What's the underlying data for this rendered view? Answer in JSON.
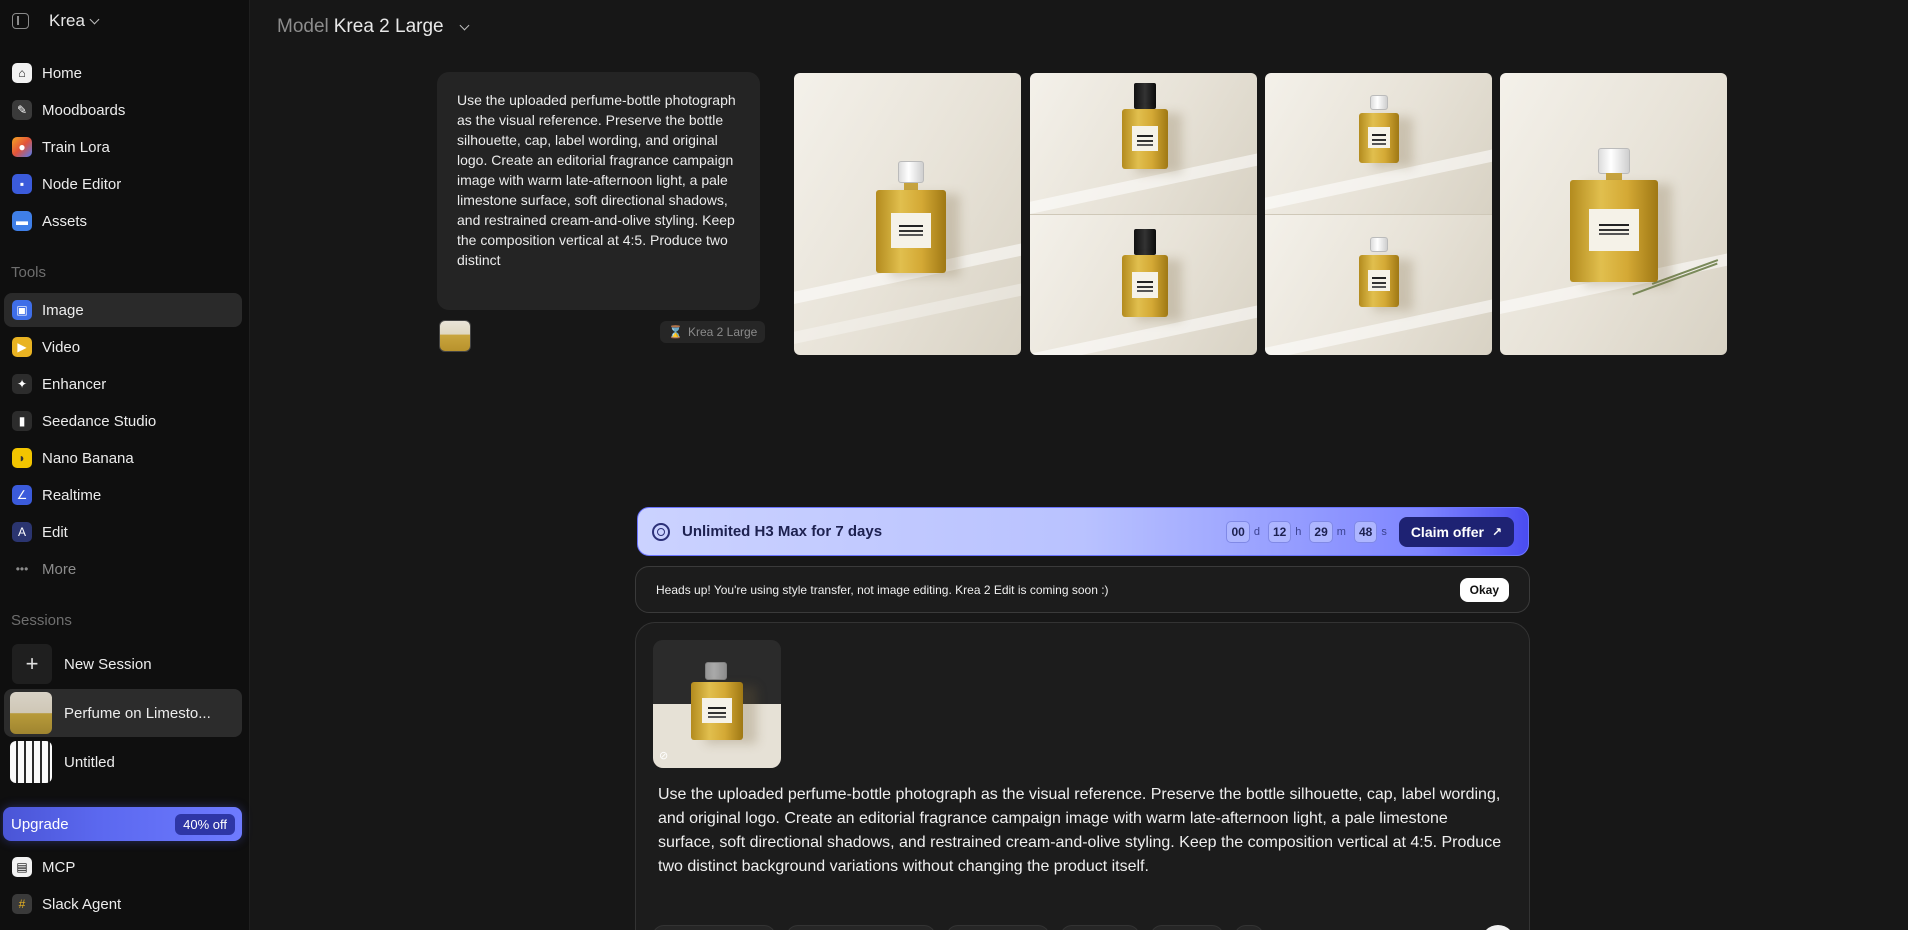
{
  "app": {
    "name": "Krea"
  },
  "sidebar": {
    "nav": [
      {
        "label": "Home",
        "icon": "home-icon"
      },
      {
        "label": "Moodboards",
        "icon": "moodboard-icon"
      },
      {
        "label": "Train Lora",
        "icon": "train-lora-icon"
      },
      {
        "label": "Node Editor",
        "icon": "node-editor-icon"
      },
      {
        "label": "Assets",
        "icon": "folder-icon"
      }
    ],
    "tools_label": "Tools",
    "tools": [
      {
        "label": "Image",
        "icon": "image-icon"
      },
      {
        "label": "Video",
        "icon": "video-icon"
      },
      {
        "label": "Enhancer",
        "icon": "enhancer-icon"
      },
      {
        "label": "Seedance Studio",
        "icon": "seedance-icon"
      },
      {
        "label": "Nano Banana",
        "icon": "banana-icon"
      },
      {
        "label": "Realtime",
        "icon": "realtime-icon"
      },
      {
        "label": "Edit",
        "icon": "edit-icon"
      },
      {
        "label": "More",
        "icon": "more-icon"
      }
    ],
    "sessions_label": "Sessions",
    "new_session": "New Session",
    "sessions": [
      {
        "label": "Perfume on Limesto..."
      },
      {
        "label": "Untitled"
      }
    ],
    "upgrade": {
      "label": "Upgrade",
      "badge": "40% off"
    },
    "footer": [
      {
        "label": "MCP",
        "icon": "mcp-icon"
      },
      {
        "label": "Slack Agent",
        "icon": "slack-icon"
      }
    ]
  },
  "header": {
    "model_prefix": "Model",
    "model_value": "Krea 2 Large"
  },
  "history": {
    "prompt": "Use the uploaded perfume-bottle photograph as the visual reference. Preserve the bottle silhouette, cap, label wording, and original logo. Create an editorial fragrance campaign image with warm late-afternoon light, a pale limestone surface, soft directional shadows, and restrained cream-and-olive styling. Keep the composition vertical at 4:5. Produce two distinct",
    "model_chip": "Krea 2 Large"
  },
  "offer": {
    "title": "Unlimited H3 Max for 7 days",
    "countdown": [
      {
        "value": "00",
        "unit": "d"
      },
      {
        "value": "12",
        "unit": "h"
      },
      {
        "value": "29",
        "unit": "m"
      },
      {
        "value": "48",
        "unit": "s"
      }
    ],
    "cta": "Claim offer"
  },
  "notice": {
    "text": "Heads up! You're using style transfer, not image editing. Krea 2 Edit is coming soon :)",
    "button": "Okay"
  },
  "composer": {
    "text": "Use the uploaded perfume-bottle photograph as the visual reference. Preserve the bottle silhouette, cap, label wording, and original logo. Create an editorial fragrance campaign image with warm late-afternoon light, a pale limestone surface, soft directional shadows, and restrained cream-and-olive styling. Keep the composition vertical at 4:5. Produce two distinct background variations without changing the product itself."
  },
  "colors": {
    "accent": "#5b68ef",
    "offer_button": "#1e2273"
  }
}
